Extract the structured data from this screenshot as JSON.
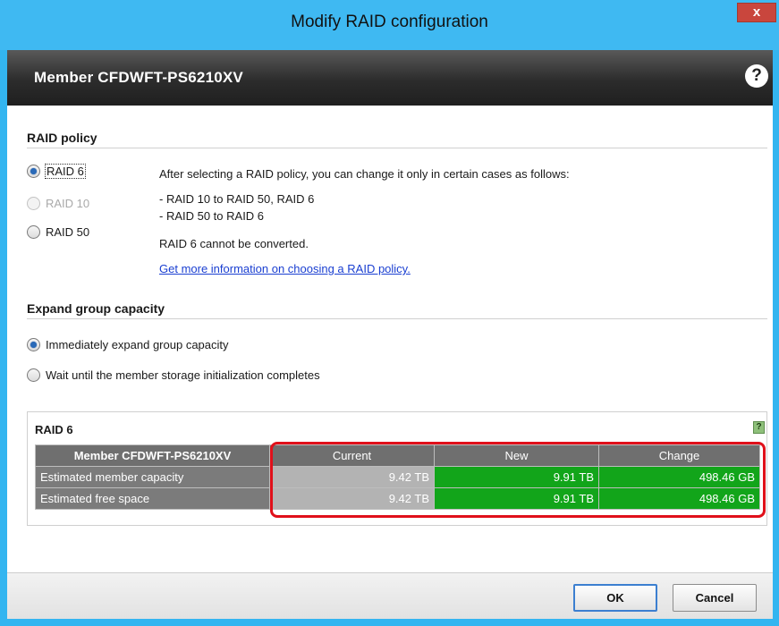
{
  "window": {
    "title": "Modify RAID configuration",
    "close_label": "x"
  },
  "header": {
    "title": "Member CFDWFT-PS6210XV",
    "help_label": "?"
  },
  "raid_policy": {
    "section_title": "RAID policy",
    "options": [
      {
        "label": "RAID 6",
        "checked": true,
        "disabled": false
      },
      {
        "label": "RAID 10",
        "checked": false,
        "disabled": true
      },
      {
        "label": "RAID 50",
        "checked": false,
        "disabled": false
      }
    ],
    "info_intro": "After selecting a RAID policy, you can change it only in certain cases as follows:",
    "info_line1": "- RAID 10 to RAID 50, RAID 6",
    "info_line2": "- RAID 50 to RAID 6",
    "info_note": "RAID 6 cannot be converted.",
    "info_link": "Get more information on choosing a RAID policy."
  },
  "expand_capacity": {
    "section_title": "Expand group capacity",
    "options": [
      {
        "label": "Immediately expand group capacity",
        "checked": true
      },
      {
        "label": "Wait until the member storage initialization completes",
        "checked": false
      }
    ]
  },
  "summary": {
    "title": "RAID 6",
    "help_label": "?",
    "columns": [
      "Member CFDWFT-PS6210XV",
      "Current",
      "New",
      "Change"
    ],
    "rows": [
      {
        "label": "Estimated member capacity",
        "current": "9.42 TB",
        "new": "9.91 TB",
        "change": "498.46 GB"
      },
      {
        "label": "Estimated free space",
        "current": "9.42 TB",
        "new": "9.91 TB",
        "change": "498.46 GB"
      }
    ]
  },
  "footer": {
    "ok_label": "OK",
    "cancel_label": "Cancel"
  },
  "colors": {
    "title_bar": "#3fb9f2",
    "close_button": "#c9463d",
    "changed_value": "#12a51a",
    "highlight_border": "#e0101a"
  }
}
